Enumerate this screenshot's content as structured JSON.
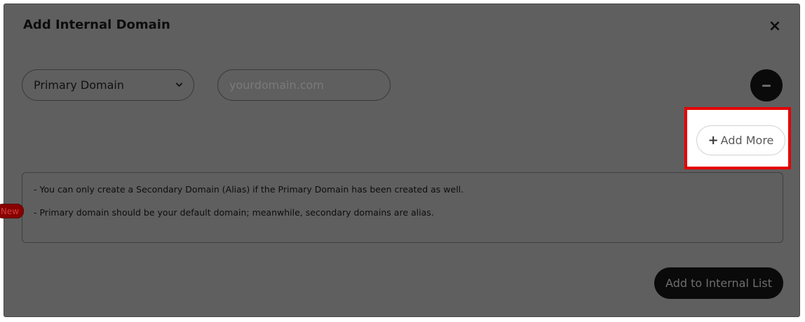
{
  "modal": {
    "title": "Add Internal Domain",
    "close_symbol": "×"
  },
  "domain_row": {
    "type_select_value": "Primary Domain",
    "domain_input_placeholder": "yourdomain.com"
  },
  "add_more": {
    "plus": "+",
    "label": "Add More"
  },
  "info": {
    "lines": [
      "- You can only create a Secondary Domain (Alias) if the Primary Domain has been created as well.",
      "- Primary domain should be your default domain; meanwhile, secondary domains are alias."
    ],
    "badge": "New"
  },
  "submit_label": "Add to Internal List",
  "icons": {
    "close": "close-icon",
    "select_arrow": "chevron-down-icon",
    "remove": "minus-icon",
    "add": "plus-icon"
  },
  "colors": {
    "overlay": "#5f5f5f",
    "highlight": "#e50000",
    "button_dark": "#0a0a0a",
    "badge": "#8a0000"
  }
}
